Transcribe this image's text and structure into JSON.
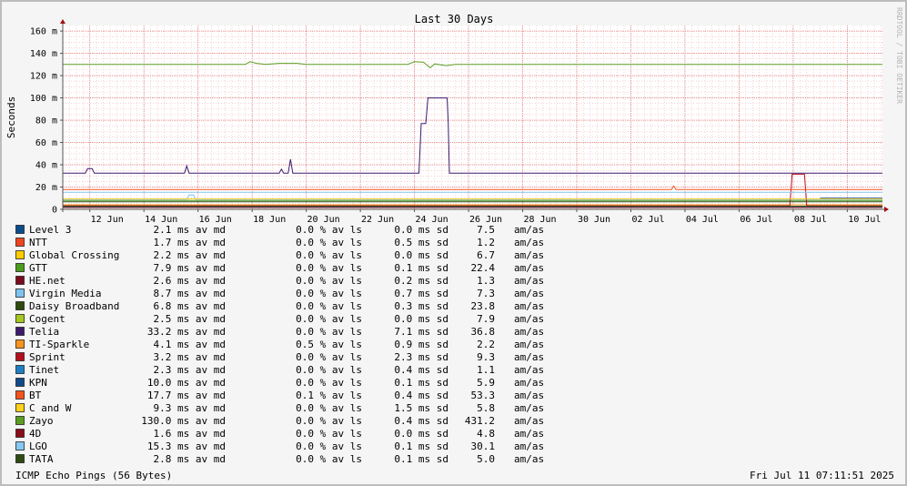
{
  "chart_data": {
    "type": "line",
    "title": "Last 30 Days",
    "ylabel": "Seconds",
    "watermark": "RRDTOOL / TOBI OETIKER",
    "ylim": [
      0,
      0.165
    ],
    "y_ticks": [
      0,
      0.02,
      0.04,
      0.06,
      0.08,
      0.1,
      0.12,
      0.14,
      0.16
    ],
    "y_tick_labels": [
      "0",
      "20 m",
      "40 m",
      "60 m",
      "80 m",
      "100 m",
      "120 m",
      "140 m",
      "160 m"
    ],
    "x_range": [
      "2025-06-11T00:00",
      "2025-07-11T07:11"
    ],
    "x_ticks": [
      "2025-06-12",
      "2025-06-14",
      "2025-06-16",
      "2025-06-18",
      "2025-06-20",
      "2025-06-22",
      "2025-06-24",
      "2025-06-26",
      "2025-06-28",
      "2025-06-30",
      "2025-07-02",
      "2025-07-04",
      "2025-07-06",
      "2025-07-08",
      "2025-07-10"
    ],
    "x_tick_labels": [
      "12 Jun",
      "14 Jun",
      "16 Jun",
      "18 Jun",
      "20 Jun",
      "22 Jun",
      "24 Jun",
      "26 Jun",
      "28 Jun",
      "30 Jun",
      "02 Jul",
      "04 Jul",
      "06 Jul",
      "08 Jul",
      "10 Jul"
    ],
    "grid": true,
    "legend_placement": "bottom",
    "stat_suffixes": {
      "avg": "ms av md",
      "loss": "% av ls",
      "sd": "ms sd",
      "ratio": "am/as"
    },
    "series": [
      {
        "name": "Level 3",
        "color": "#0b4c8c",
        "avg": "2.1",
        "loss": "0.0",
        "sd": "0.0",
        "ratio": "7.5",
        "points": [
          [
            "2025-06-11T00:00",
            0.0021
          ],
          [
            "2025-07-11T07:11",
            0.0021
          ]
        ]
      },
      {
        "name": "NTT",
        "color": "#f0451c",
        "avg": "1.7",
        "loss": "0.0",
        "sd": "0.5",
        "ratio": "1.2",
        "points": [
          [
            "2025-06-11T00:00",
            0.0017
          ],
          [
            "2025-07-11T07:11",
            0.0017
          ]
        ]
      },
      {
        "name": "Global Crossing",
        "color": "#ffcc00",
        "avg": "2.2",
        "loss": "0.0",
        "sd": "0.0",
        "ratio": "6.7",
        "points": [
          [
            "2025-06-11T00:00",
            0.0022
          ],
          [
            "2025-07-11T07:11",
            0.0022
          ]
        ]
      },
      {
        "name": "GTT",
        "color": "#4a9c1c",
        "avg": "7.9",
        "loss": "0.0",
        "sd": "0.1",
        "ratio": "22.4",
        "points": [
          [
            "2025-06-11T00:00",
            0.0079
          ],
          [
            "2025-07-11T07:11",
            0.0079
          ]
        ]
      },
      {
        "name": "HE.net",
        "color": "#7a0a1e",
        "avg": "2.6",
        "loss": "0.0",
        "sd": "0.2",
        "ratio": "1.3",
        "points": [
          [
            "2025-06-11T00:00",
            0.0026
          ],
          [
            "2025-07-11T07:11",
            0.0026
          ]
        ]
      },
      {
        "name": "Virgin Media",
        "color": "#7ec4f0",
        "avg": "8.7",
        "loss": "0.0",
        "sd": "0.7",
        "ratio": "7.3",
        "points": [
          [
            "2025-06-11T00:00",
            0.0087
          ],
          [
            "2025-06-15T14:00",
            0.0087
          ],
          [
            "2025-06-15T16:00",
            0.013
          ],
          [
            "2025-06-15T20:00",
            0.013
          ],
          [
            "2025-06-15T22:00",
            0.0087
          ],
          [
            "2025-07-11T07:11",
            0.0087
          ]
        ]
      },
      {
        "name": "Daisy Broadband",
        "color": "#2e4a0e",
        "avg": "6.8",
        "loss": "0.0",
        "sd": "0.3",
        "ratio": "23.8",
        "points": [
          [
            "2025-06-11T00:00",
            0.0068
          ],
          [
            "2025-07-11T07:11",
            0.0068
          ]
        ]
      },
      {
        "name": "Cogent",
        "color": "#a6c81e",
        "avg": "2.5",
        "loss": "0.0",
        "sd": "0.0",
        "ratio": "7.9",
        "points": [
          [
            "2025-06-11T00:00",
            0.0025
          ],
          [
            "2025-07-11T07:11",
            0.0025
          ]
        ]
      },
      {
        "name": "Telia",
        "color": "#3d1a6e",
        "avg": "33.2",
        "loss": "0.0",
        "sd": "7.1",
        "ratio": "36.8",
        "points": [
          [
            "2025-06-11T00:00",
            0.0325
          ],
          [
            "2025-06-11T20:00",
            0.0325
          ],
          [
            "2025-06-11T22:00",
            0.0365
          ],
          [
            "2025-06-12T02:00",
            0.0365
          ],
          [
            "2025-06-12T04:00",
            0.0325
          ],
          [
            "2025-06-15T12:00",
            0.0325
          ],
          [
            "2025-06-15T14:00",
            0.039
          ],
          [
            "2025-06-15T16:00",
            0.0325
          ],
          [
            "2025-06-19T00:00",
            0.0325
          ],
          [
            "2025-06-19T02:00",
            0.036
          ],
          [
            "2025-06-19T04:00",
            0.0325
          ],
          [
            "2025-06-19T08:00",
            0.0325
          ],
          [
            "2025-06-19T10:00",
            0.045
          ],
          [
            "2025-06-19T12:00",
            0.0325
          ],
          [
            "2025-06-24T04:00",
            0.0325
          ],
          [
            "2025-06-24T06:00",
            0.077
          ],
          [
            "2025-06-24T10:00",
            0.077
          ],
          [
            "2025-06-24T12:00",
            0.1
          ],
          [
            "2025-06-25T05:00",
            0.1
          ],
          [
            "2025-06-25T06:00",
            0.078
          ],
          [
            "2025-06-25T07:00",
            0.0325
          ],
          [
            "2025-07-11T07:11",
            0.0325
          ]
        ]
      },
      {
        "name": "TI-Sparkle",
        "color": "#f7941e",
        "avg": "4.1",
        "loss": "0.5",
        "sd": "0.9",
        "ratio": "2.2",
        "points": [
          [
            "2025-06-11T00:00",
            0.0041
          ],
          [
            "2025-07-11T07:11",
            0.0041
          ]
        ]
      },
      {
        "name": "Sprint",
        "color": "#b2111b",
        "avg": "3.2",
        "loss": "0.0",
        "sd": "2.3",
        "ratio": "9.3",
        "points": [
          [
            "2025-06-11T00:00",
            0.0032
          ],
          [
            "2025-07-07T21:00",
            0.0032
          ],
          [
            "2025-07-07T23:00",
            0.0315
          ],
          [
            "2025-07-08T10:00",
            0.0315
          ],
          [
            "2025-07-08T12:00",
            0.0032
          ],
          [
            "2025-07-11T07:11",
            0.0032
          ]
        ]
      },
      {
        "name": "Tinet",
        "color": "#1f7fc4",
        "avg": "2.3",
        "loss": "0.0",
        "sd": "0.4",
        "ratio": "1.1",
        "points": [
          [
            "2025-06-11T00:00",
            0.0023
          ],
          [
            "2025-07-11T07:11",
            0.0023
          ]
        ]
      },
      {
        "name": "KPN",
        "color": "#114a8a",
        "avg": "10.0",
        "loss": "0.0",
        "sd": "0.1",
        "ratio": "5.9",
        "points": [
          [
            "2025-07-09T00:00",
            0.01
          ],
          [
            "2025-07-11T07:11",
            0.01
          ]
        ]
      },
      {
        "name": "BT",
        "color": "#f2541e",
        "avg": "17.7",
        "loss": "0.1",
        "sd": "0.4",
        "ratio": "53.3",
        "points": [
          [
            "2025-06-11T00:00",
            0.0177
          ],
          [
            "2025-07-03T12:00",
            0.0177
          ],
          [
            "2025-07-03T14:00",
            0.021
          ],
          [
            "2025-07-03T16:00",
            0.0177
          ],
          [
            "2025-07-11T07:11",
            0.0177
          ]
        ]
      },
      {
        "name": "C and W",
        "color": "#ffd21a",
        "avg": "9.3",
        "loss": "0.0",
        "sd": "1.5",
        "ratio": "5.8",
        "points": [
          [
            "2025-06-11T00:00",
            0.0093
          ],
          [
            "2025-07-11T07:11",
            0.0093
          ]
        ]
      },
      {
        "name": "Zayo",
        "color": "#5a9e22",
        "avg": "130.0",
        "loss": "0.0",
        "sd": "0.4",
        "ratio": "431.2",
        "points": [
          [
            "2025-06-11T00:00",
            0.13
          ],
          [
            "2025-06-17T18:00",
            0.13
          ],
          [
            "2025-06-17T22:00",
            0.1325
          ],
          [
            "2025-06-18T04:00",
            0.131
          ],
          [
            "2025-06-18T12:00",
            0.13
          ],
          [
            "2025-06-19T00:00",
            0.131
          ],
          [
            "2025-06-19T16:00",
            0.131
          ],
          [
            "2025-06-20T00:00",
            0.13
          ],
          [
            "2025-06-23T18:00",
            0.13
          ],
          [
            "2025-06-24T00:00",
            0.1325
          ],
          [
            "2025-06-24T08:00",
            0.132
          ],
          [
            "2025-06-24T14:00",
            0.127
          ],
          [
            "2025-06-24T18:00",
            0.1305
          ],
          [
            "2025-06-25T04:00",
            0.129
          ],
          [
            "2025-06-25T12:00",
            0.13
          ],
          [
            "2025-07-11T07:11",
            0.13
          ]
        ]
      },
      {
        "name": "4D",
        "color": "#8a0d1c",
        "avg": "1.6",
        "loss": "0.0",
        "sd": "0.0",
        "ratio": "4.8",
        "points": [
          [
            "2025-06-11T00:00",
            0.0016
          ],
          [
            "2025-07-11T07:11",
            0.0016
          ]
        ]
      },
      {
        "name": "LGO",
        "color": "#86c9f2",
        "avg": "15.3",
        "loss": "0.0",
        "sd": "0.1",
        "ratio": "30.1",
        "points": [
          [
            "2025-06-11T00:00",
            0.0153
          ],
          [
            "2025-07-11T07:11",
            0.0153
          ]
        ]
      },
      {
        "name": "TATA",
        "color": "#2f4a11",
        "avg": "2.8",
        "loss": "0.0",
        "sd": "0.1",
        "ratio": "5.0",
        "points": [
          [
            "2025-06-11T00:00",
            0.0028
          ],
          [
            "2025-07-11T07:11",
            0.0028
          ]
        ]
      }
    ]
  },
  "footer": {
    "left": "ICMP Echo Pings (56 Bytes)",
    "right": "Fri Jul 11 07:11:51 2025"
  }
}
